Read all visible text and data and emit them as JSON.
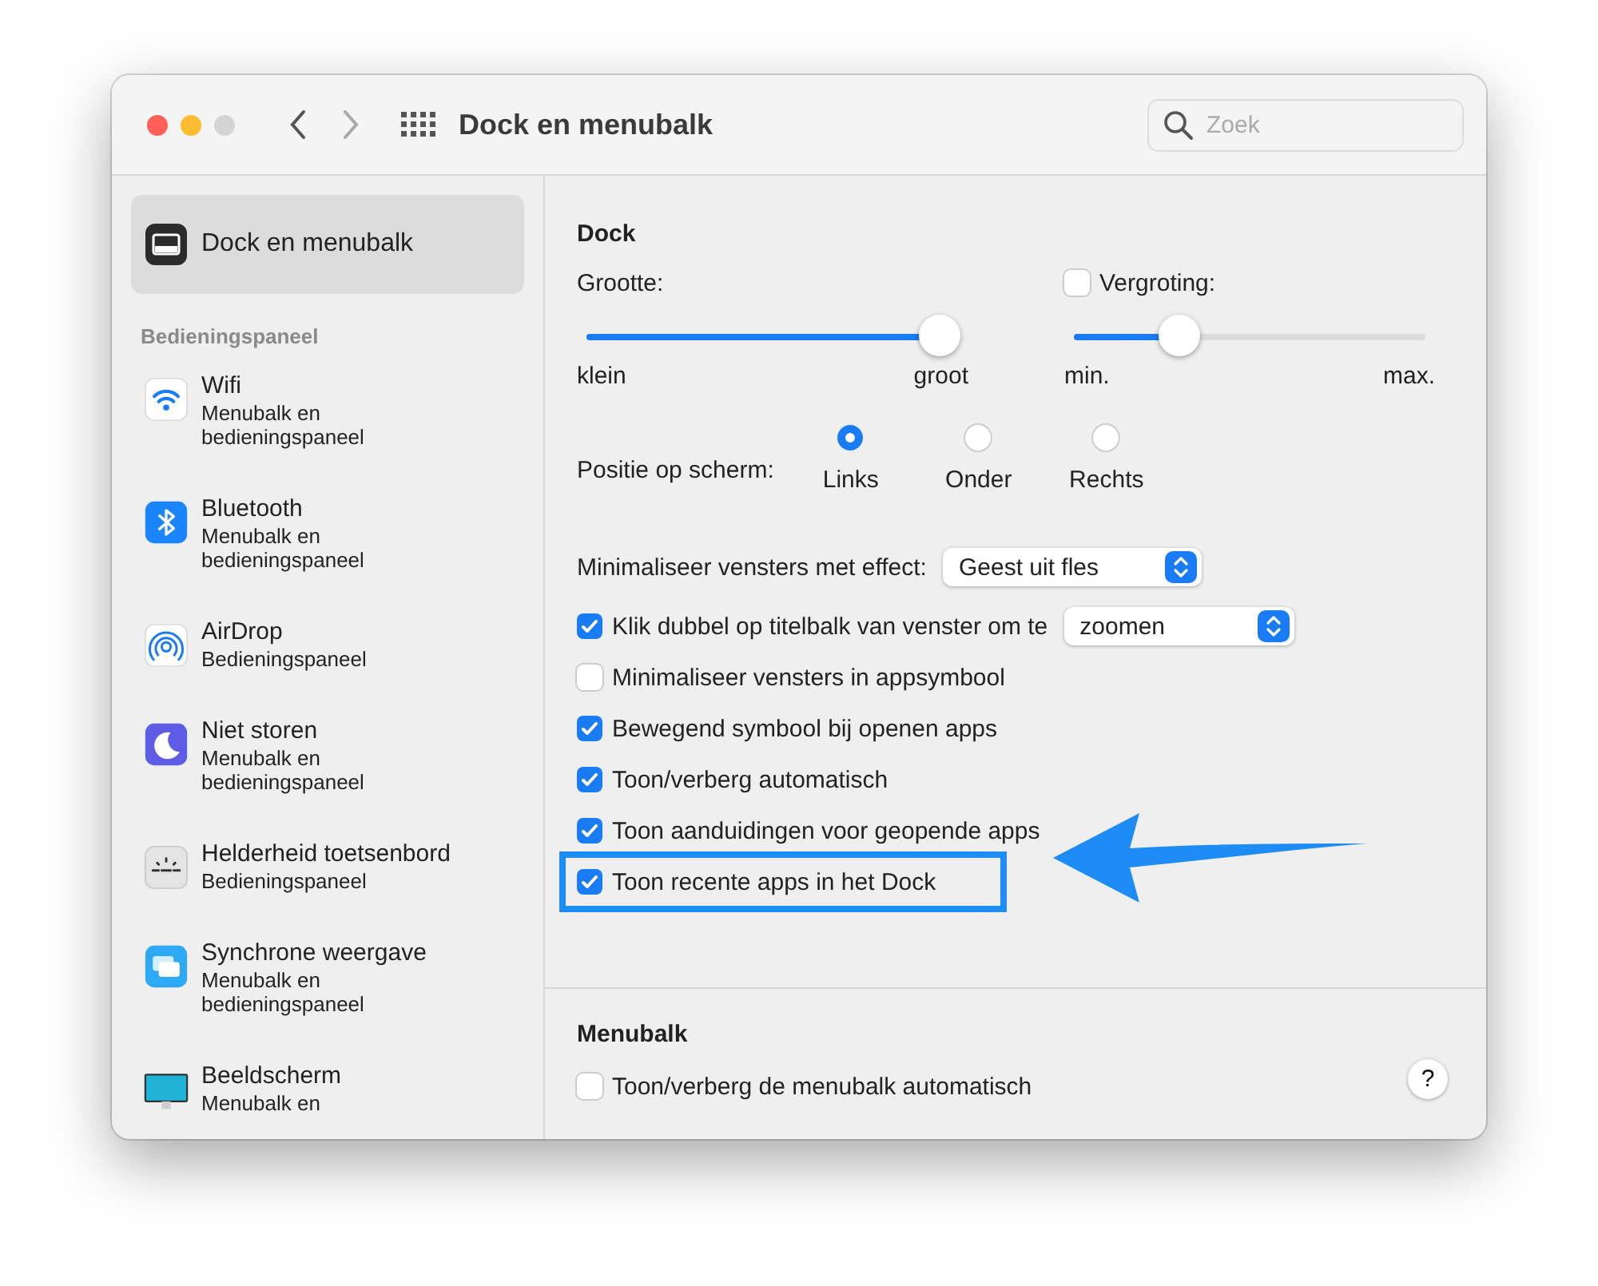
{
  "window": {
    "title": "Dock en menubalk",
    "search": {
      "placeholder": "Zoek"
    }
  },
  "sidebar": {
    "selected_item": {
      "label": "Dock en menubalk",
      "selected": true
    },
    "section_header": "Bedieningspaneel",
    "items": [
      {
        "title": "Wifi",
        "subtitle": "Menubalk en bedieningspaneel",
        "selected": false
      },
      {
        "title": "Bluetooth",
        "subtitle": "Menubalk en bedieningspaneel",
        "selected": false
      },
      {
        "title": "AirDrop",
        "subtitle": "Bedieningspaneel",
        "selected": false
      },
      {
        "title": "Niet storen",
        "subtitle": "Menubalk en bedieningspaneel",
        "selected": false
      },
      {
        "title": "Helderheid toetsenbord",
        "subtitle": "Bedieningspaneel",
        "selected": false
      },
      {
        "title": "Synchrone weergave",
        "subtitle": "Menubalk en bedieningspaneel",
        "selected": false
      },
      {
        "title": "Beeldscherm",
        "subtitle": "Menubalk en",
        "selected": false
      }
    ]
  },
  "dock": {
    "heading": "Dock",
    "size": {
      "label": "Grootte:",
      "level": 0.95,
      "min_label": "klein",
      "max_label": "groot"
    },
    "magnification": {
      "label": "Vergroting:",
      "checked": false,
      "level": 0.3,
      "min_label": "min.",
      "max_label": "max."
    },
    "position": {
      "label": "Positie op scherm:",
      "options": [
        {
          "label": "Links",
          "selected": true
        },
        {
          "label": "Onder",
          "selected": false
        },
        {
          "label": "Rechts",
          "selected": false
        }
      ]
    },
    "options": [
      {
        "kind": "select",
        "label": "Minimaliseer vensters met effect:",
        "value": "Geest uit fles",
        "highlighted": false
      },
      {
        "kind": "checkbox_select",
        "label": "Klik dubbel op titelbalk van venster om te",
        "checked": true,
        "value": "zoomen",
        "highlighted": false
      },
      {
        "kind": "checkbox",
        "label": "Minimaliseer vensters in appsymbool",
        "checked": false,
        "highlighted": false
      },
      {
        "kind": "checkbox",
        "label": "Bewegend symbool bij openen apps",
        "checked": true,
        "highlighted": false
      },
      {
        "kind": "checkbox",
        "label": "Toon/verberg automatisch",
        "checked": true,
        "highlighted": false
      },
      {
        "kind": "checkbox",
        "label": "Toon aanduidingen voor geopende apps",
        "checked": true,
        "highlighted": false
      },
      {
        "kind": "checkbox",
        "label": "Toon recente apps in het Dock",
        "checked": true,
        "highlighted": true
      }
    ]
  },
  "menubar": {
    "heading": "Menubalk",
    "option": {
      "label": "Toon/verberg de menubalk automatisch",
      "checked": false
    },
    "help_button": "?"
  }
}
